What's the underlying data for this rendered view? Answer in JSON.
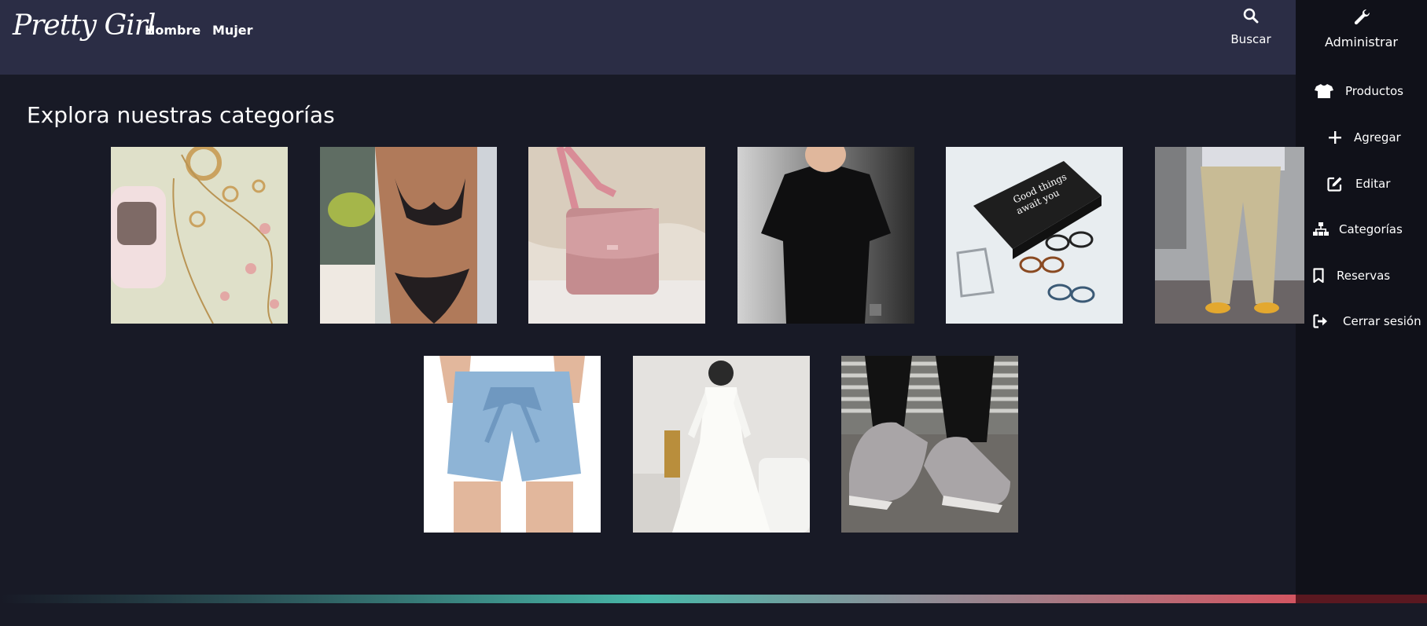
{
  "brand": {
    "logo": "Pretty Girl"
  },
  "nav": {
    "hombre": "Hombre",
    "mujer": "Mujer"
  },
  "search": {
    "label": "Buscar",
    "icon": "search-icon"
  },
  "admin": {
    "label": "Administrar",
    "icon": "wrench-icon",
    "items": [
      {
        "label": "Productos",
        "icon": "tshirt-icon"
      },
      {
        "label": "Agregar",
        "icon": "plus-icon"
      },
      {
        "label": "Editar",
        "icon": "edit-icon"
      },
      {
        "label": "Categorías",
        "icon": "sitemap-icon"
      },
      {
        "label": "Reservas",
        "icon": "bookmark-icon"
      },
      {
        "label": "Cerrar sesión",
        "icon": "sign-out-icon"
      }
    ]
  },
  "main": {
    "heading": "Explora nuestras categorías"
  },
  "colors": {
    "background": "#181a26",
    "topbar": "#2b2d45",
    "sidebar": "#101119",
    "accent_teal": "#48b7a8",
    "accent_red": "#d25561"
  }
}
